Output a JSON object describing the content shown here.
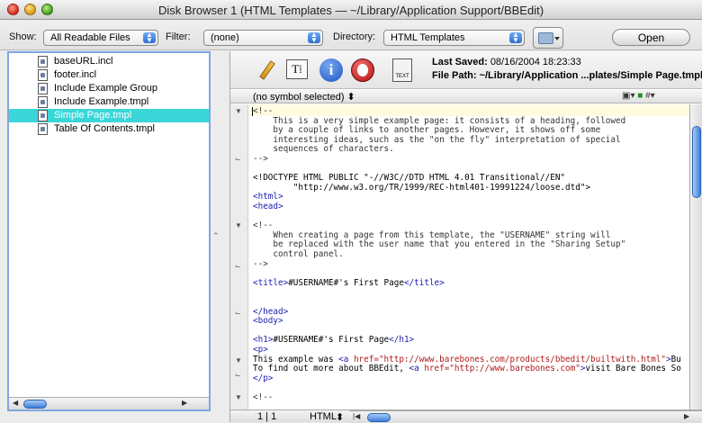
{
  "window": {
    "title": "Disk Browser 1 (HTML Templates — ~/Library/Application Support/BBEdit)"
  },
  "toolbar": {
    "show_label": "Show:",
    "show_value": "All Readable Files",
    "filter_label": "Filter:",
    "filter_value": "(none)",
    "directory_label": "Directory:",
    "directory_value": "HTML Templates",
    "open_label": "Open"
  },
  "files": [
    {
      "name": "baseURL.incl",
      "selected": false
    },
    {
      "name": "footer.incl",
      "selected": false
    },
    {
      "name": "Include Example Group",
      "selected": false
    },
    {
      "name": "Include Example.tmpl",
      "selected": false
    },
    {
      "name": "Simple Page.tmpl",
      "selected": true
    },
    {
      "name": "Table Of Contents.tmpl",
      "selected": false
    }
  ],
  "editor": {
    "saved_label": "Last Saved:",
    "saved_value": "08/16/2004 18:23:33",
    "path_label": "File Path:",
    "path_value": "~/Library/Application ...plates/Simple Page.tmpl",
    "text_icon_label": "TEXT",
    "symbol_menu": "(no symbol selected)",
    "status_line": "1 | 1",
    "status_lang": "HTML"
  },
  "code_lines": [
    "<!--",
    "    This is a very simple example page: it consists of a heading, followed",
    "    by a couple of links to another pages. However, it shows off some",
    "    interesting ideas, such as the \"on the fly\" interpretation of special",
    "    sequences of characters.",
    "-->",
    "",
    "<!DOCTYPE HTML PUBLIC \"-//W3C//DTD HTML 4.01 Transitional//EN\"",
    "        \"http://www.w3.org/TR/1999/REC-html401-19991224/loose.dtd\">",
    "<html>",
    "<head>",
    "",
    "<!--",
    "    When creating a page from this template, the \"USERNAME\" string will",
    "    be replaced with the user name that you entered in the \"Sharing Setup\"",
    "    control panel.",
    "-->",
    "",
    "<title>#USERNAME#'s First Page</title>",
    "",
    "",
    "</head>",
    "<body>",
    "",
    "<h1>#USERNAME#'s First Page</h1>",
    "<p>",
    "This example was <a href=\"http://www.barebones.com/products/bbedit/builtwith.html\">Bu",
    "To find out more about BBEdit, <a href=\"http://www.barebones.com\">visit Bare Bones So",
    "</p>",
    "",
    "<!--"
  ],
  "colors": {
    "selection": "#3ad6d8",
    "tag": "#1a1ab0",
    "attribute": "#b01a1a",
    "pane_border": "#7ea8e0"
  }
}
